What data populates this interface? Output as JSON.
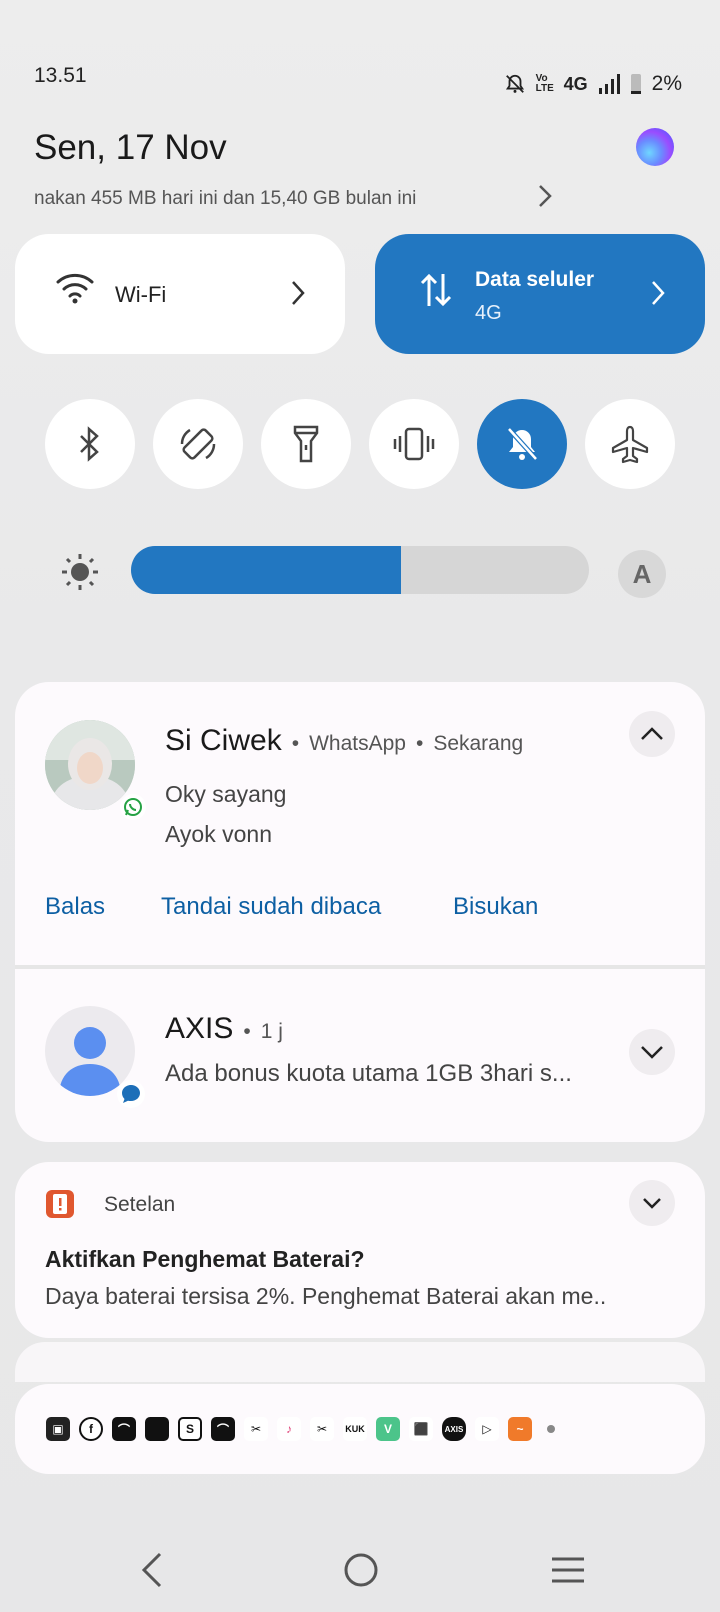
{
  "status": {
    "time": "13.51",
    "network": "4G",
    "battery": "2%",
    "volte": "Vo LTE",
    "icons": [
      "bell-off-icon",
      "volte-icon",
      "signal-icon",
      "battery-icon"
    ]
  },
  "header": {
    "date": "Sen, 17 Nov",
    "usage": "nakan 455 MB hari ini dan 15,40 GB bulan ini"
  },
  "tiles": {
    "wifi": {
      "label": "Wi-Fi"
    },
    "data": {
      "label": "Data seluler",
      "sub": "4G"
    }
  },
  "toggles": [
    {
      "name": "bluetooth",
      "icon": "bluetooth-icon",
      "active": false
    },
    {
      "name": "auto-rotate",
      "icon": "rotate-icon",
      "active": false
    },
    {
      "name": "flashlight",
      "icon": "flashlight-icon",
      "active": false
    },
    {
      "name": "vibrate",
      "icon": "vibrate-icon",
      "active": false
    },
    {
      "name": "silent",
      "icon": "bell-off-icon",
      "active": true
    },
    {
      "name": "airplane",
      "icon": "airplane-icon",
      "active": false
    }
  ],
  "brightness": {
    "level": 0.59,
    "auto_label": "A"
  },
  "notifications": {
    "whatsapp": {
      "sender": "Si Ciwek",
      "app": "WhatsApp",
      "time": "Sekarang",
      "lines": [
        "Oky sayang",
        "Ayok vonn"
      ],
      "actions": [
        "Balas",
        "Tandai sudah dibaca",
        "Bisukan"
      ]
    },
    "axis": {
      "sender": "AXIS",
      "time": "1 j",
      "text": "Ada bonus kuota utama 1GB 3hari s..."
    },
    "setelan": {
      "app": "Setelan",
      "title": "Aktifkan Penghemat Baterai?",
      "text": "Daya baterai tersisa 2%. Penghemat Baterai akan me.."
    }
  },
  "app_strip": [
    "icon",
    "facebook",
    "shop",
    "app",
    "shop-s",
    "shop-2",
    "capcut",
    "tiktok",
    "capcut-2",
    "kuk",
    "vidio",
    "android",
    "axis",
    "play",
    "mi",
    "more"
  ],
  "colors": {
    "accent": "#2277c1",
    "action_text": "#0d5fa3"
  }
}
